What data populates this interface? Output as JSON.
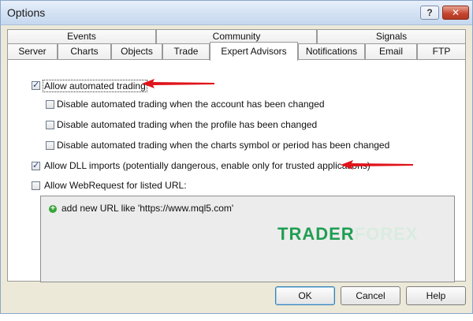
{
  "window": {
    "title": "Options",
    "help_glyph": "?",
    "close_glyph": "✕"
  },
  "tabs_row1": [
    "Events",
    "Community",
    "Signals"
  ],
  "tabs_row2": [
    "Server",
    "Charts",
    "Objects",
    "Trade",
    "Expert Advisors",
    "Notifications",
    "Email",
    "FTP"
  ],
  "active_tab": "Expert Advisors",
  "options": {
    "allow_automated_trading": {
      "label": "Allow automated trading",
      "checked": true
    },
    "disable_account_changed": {
      "label": "Disable automated trading when the account has been changed",
      "checked": false
    },
    "disable_profile_changed": {
      "label": "Disable automated trading when the profile has been changed",
      "checked": false
    },
    "disable_symbol_changed": {
      "label": "Disable automated trading when the charts symbol or period has been changed",
      "checked": false
    },
    "allow_dll_imports": {
      "label": "Allow DLL imports (potentially dangerous, enable only for trusted applications)",
      "checked": true
    },
    "allow_webrequest": {
      "label": "Allow WebRequest for listed URL:",
      "checked": false
    }
  },
  "url_list": {
    "add_label": "add new URL like 'https://www.mql5.com'"
  },
  "watermark": {
    "part1": "TRADER",
    "part2": "FOREX"
  },
  "buttons": {
    "ok": "OK",
    "cancel": "Cancel",
    "help": "Help"
  },
  "colors": {
    "arrow": "#e0141b",
    "watermark": "#1f9e52"
  }
}
